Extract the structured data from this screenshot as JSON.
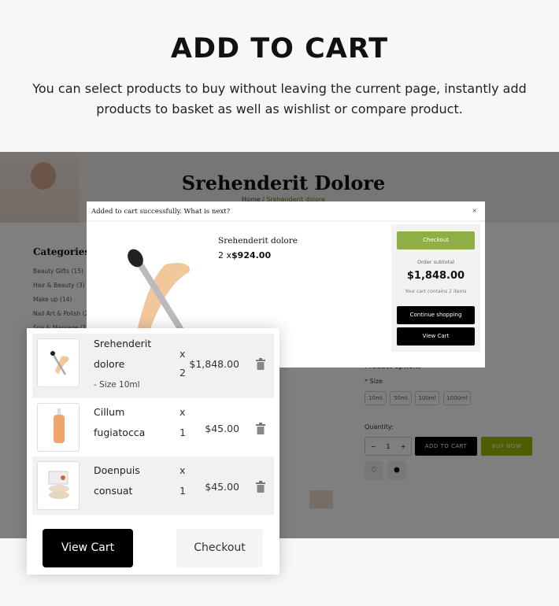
{
  "hero": {
    "title": "ADD TO CART",
    "subtitle": "You can select products to buy without leaving the current page, instantly add products to basket as well as wishlist or compare product."
  },
  "page": {
    "title": "Srehenderit Dolore",
    "breadcrumb": {
      "home": "Home",
      "sep": "/",
      "current": "Srehenderit dolore"
    },
    "categories": {
      "heading": "Categories",
      "items": [
        "Beauty Gifts (15)",
        "Hair & Beauty (3)",
        "Make up (14)",
        "Nail Art & Polish (2)",
        "Spa & Massage (18)"
      ]
    },
    "options": {
      "heading": "Product options",
      "size_label": "Size",
      "required_mark": "*",
      "sizes": [
        "10ml",
        "50ml",
        "100ml",
        "1000ml"
      ],
      "quantity_label": "Quantity:",
      "quantity": "1",
      "minus": "−",
      "plus": "+",
      "add_to_cart": "ADD TO CART",
      "buy_now": "BUY NOW"
    }
  },
  "modal": {
    "header": "Added to cart successfully. What is next?",
    "close": "×",
    "product_name": "Srehenderit dolore",
    "qty_prefix": "2 x",
    "unit_price": "$924.00",
    "checkout": "Checkout",
    "subtotal_label": "Order subtotal",
    "subtotal": "$1,848.00",
    "cart_count_text": "Your cart contains 2 items",
    "continue": "Continue shopping",
    "view_cart": "View Cart"
  },
  "mini_cart": {
    "items": [
      {
        "name1": "Srehenderit",
        "name2": "dolore",
        "option": "- Size 10ml",
        "x": "x",
        "qty": "2",
        "price": "$1,848.00"
      },
      {
        "name1": "Cillum",
        "name2": "fugiatocca",
        "x": "x",
        "qty": "1",
        "price": "$45.00"
      },
      {
        "name1": "Doenpuis",
        "name2": "consuat",
        "x": "x",
        "qty": "1",
        "price": "$45.00"
      }
    ],
    "view_cart": "View Cart",
    "checkout": "Checkout"
  },
  "colors": {
    "checkout_green": "#8fae45",
    "buy_now": "#a0b800",
    "overlay": "#7a7a7a"
  }
}
